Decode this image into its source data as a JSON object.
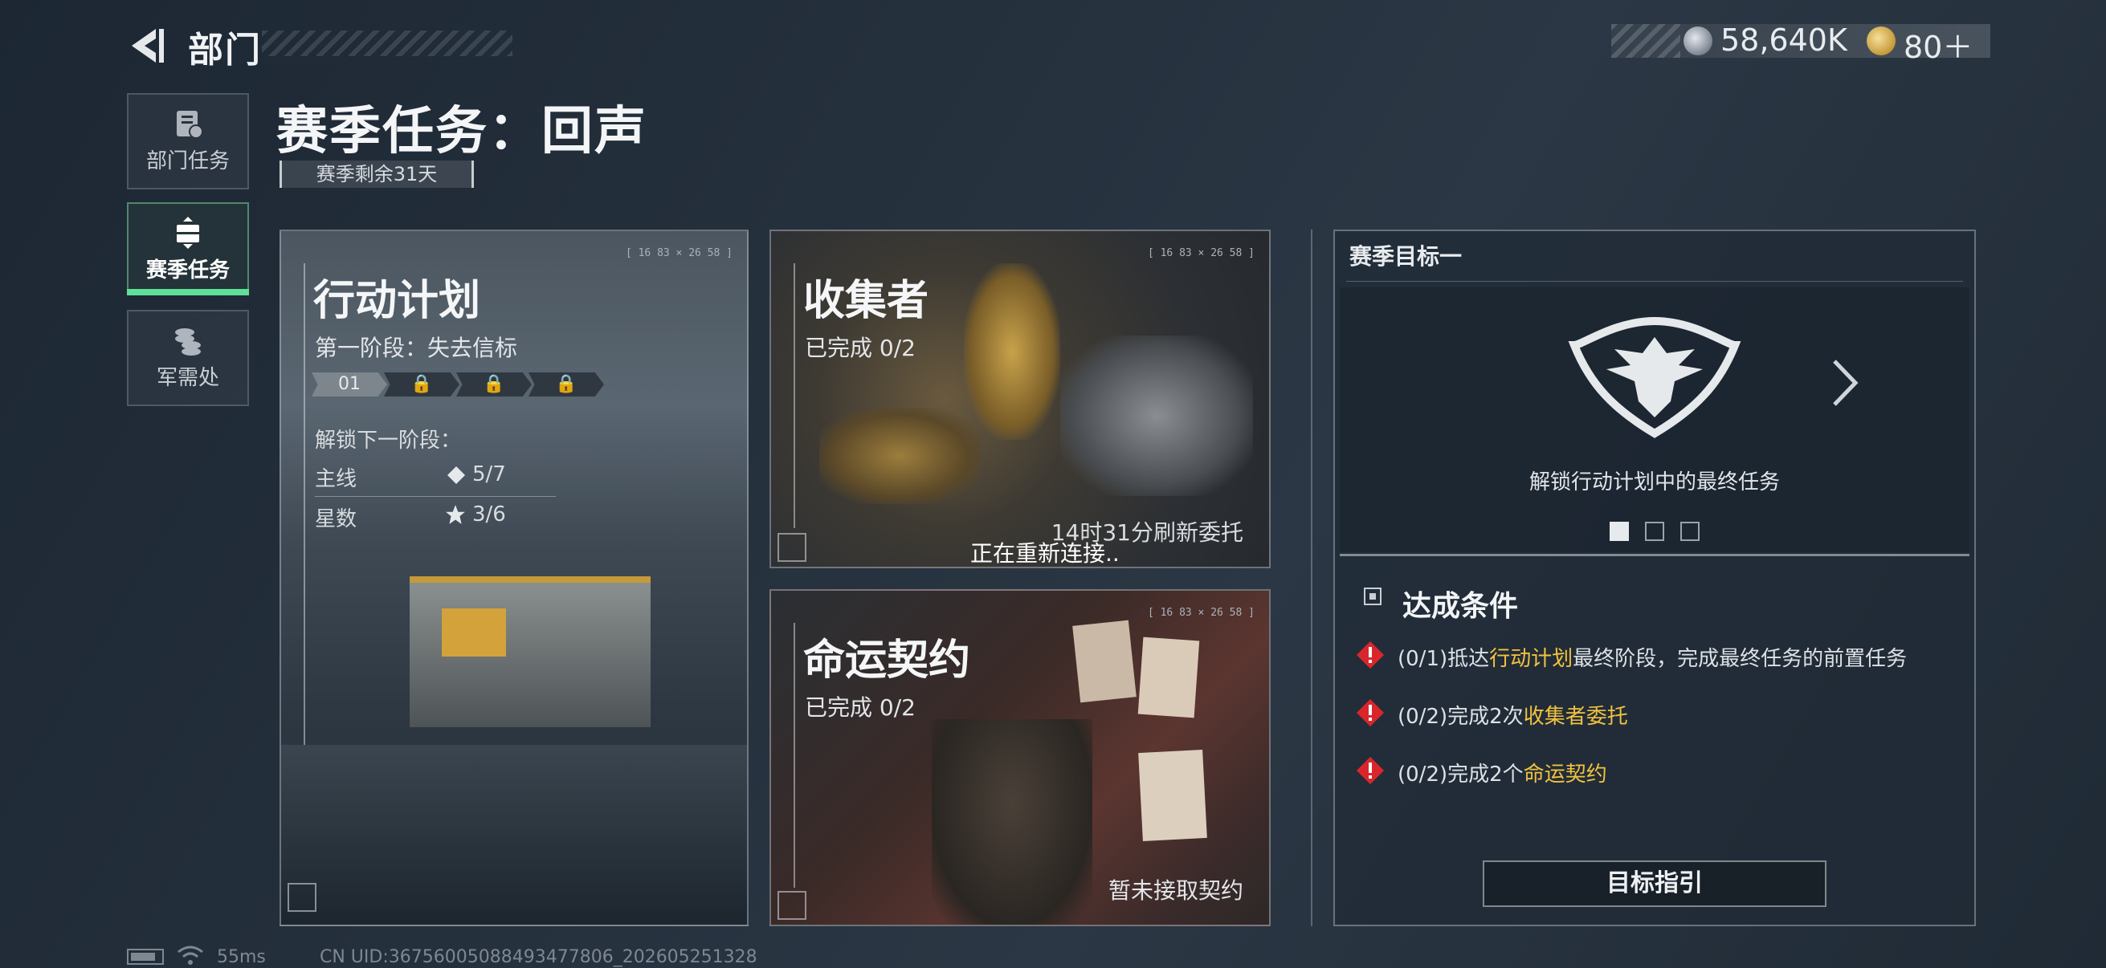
{
  "header": {
    "title": "部门"
  },
  "currency": [
    {
      "icon": "silver-coin-icon",
      "value": "58,640K"
    },
    {
      "icon": "gold-coin-icon",
      "value": "80＋"
    }
  ],
  "sidebar": {
    "items": [
      {
        "label": "部门任务",
        "icon": "clipboard-icon"
      },
      {
        "label": "赛季任务",
        "icon": "season-task-icon"
      },
      {
        "label": "军需处",
        "icon": "coins-icon"
      }
    ]
  },
  "page": {
    "title": "赛季任务：回声",
    "season_remaining": "赛季剩余31天"
  },
  "operation": {
    "title": "行动计划",
    "stage": "第一阶段：失去信标",
    "stage_current": "01",
    "unlock_label": "解锁下一阶段：",
    "main_label": "主线",
    "main_value": "5/7",
    "stars_label": "星数",
    "stars_value": "3/6",
    "coord": "[ 16 83 × 26 58 ]"
  },
  "collector": {
    "title": "收集者",
    "progress": "已完成 0/2",
    "refresh": "14时31分刷新委托",
    "reconnect": "正在重新连接..",
    "coord": "[ 16 83 × 26 58 ]"
  },
  "fate": {
    "title": "命运契约",
    "progress": "已完成 0/2",
    "status": "暂未接取契约",
    "coord": "[ 16 83 × 26 58 ]"
  },
  "goal": {
    "header": "赛季目标一",
    "emblem": "eagle-emblem-icon",
    "desc": "解锁行动计划中的最终任务",
    "conditions_title": "达成条件",
    "conditions": [
      {
        "prefix": "(0/1)抵达",
        "highlight": "行动计划",
        "suffix": "最终阶段，完成最终任务的前置任务"
      },
      {
        "prefix": "(0/2)完成2次",
        "highlight": "收集者委托",
        "suffix": ""
      },
      {
        "prefix": "(0/2)完成2个",
        "highlight": "命运契约",
        "suffix": ""
      }
    ],
    "guide_button": "目标指引"
  },
  "footer": {
    "ping": "55ms",
    "uid": "CN UID:36756005088493477806_202605251328"
  },
  "colors": {
    "accent_green": "#5fe09a",
    "highlight_gold": "#f2c23e",
    "warning_red": "#d9262b"
  }
}
